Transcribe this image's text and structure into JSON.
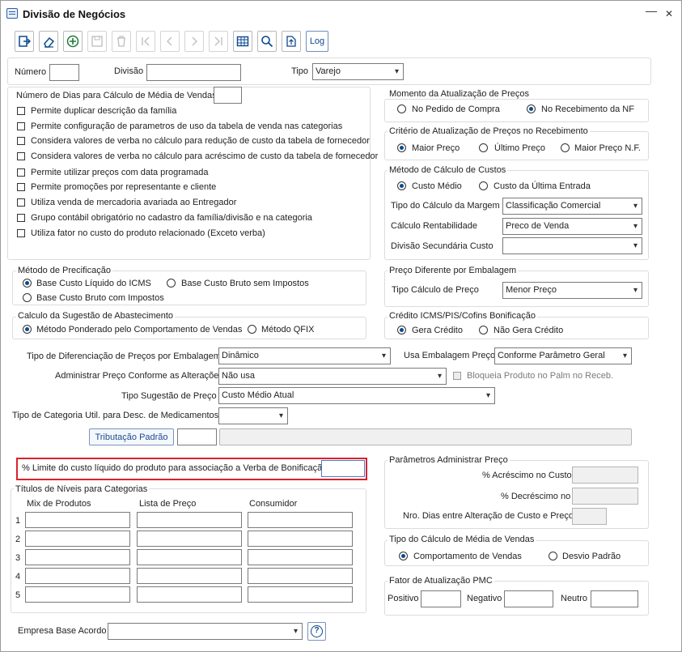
{
  "window": {
    "title": "Divisão de Negócios",
    "minimize": "—",
    "close": "✕"
  },
  "toolbar": {
    "log_label": "Log"
  },
  "header": {
    "numero_label": "Número",
    "divisao_label": "Divisão",
    "tipo_label": "Tipo",
    "tipo_value": "Varejo"
  },
  "options": {
    "dias_label": "Número de Dias para Cálculo de Média de Vendas",
    "checkboxes": [
      "Permite duplicar descrição da família",
      "Permite configuração de parametros de uso da tabela de venda nas categorias",
      "Considera valores de verba no cálculo para redução de custo da tabela de fornecedor",
      "Considera valores de verba no cálculo para acréscimo de custo da tabela de fornecedor",
      "Permite utilizar preços com data programada",
      "Permite promoções por representante e cliente",
      "Utiliza venda de mercadoria avariada ao Entregador",
      "Grupo contábil obrigatório no cadastro da família/divisão e na categoria",
      "Utiliza fator no custo do produto relacionado (Exceto verba)"
    ]
  },
  "momento": {
    "title": "Momento da Atualização de Preços",
    "opt1": "No Pedido de Compra",
    "opt2": "No Recebimento da NF"
  },
  "criterio": {
    "title": "Critério de Atualização de Preços no Recebimento",
    "opt1": "Maior Preço",
    "opt2": "Último Preço",
    "opt3": "Maior Preço N.F."
  },
  "metodo_custos": {
    "title": "Método de Cálculo de Custos",
    "opt1": "Custo Médio",
    "opt2": "Custo da Última Entrada",
    "margem_label": "Tipo do Cálculo da Margem",
    "margem_value": "Classificação Comercial",
    "rent_label": "Cálculo Rentabilidade",
    "rent_value": "Preco de Venda",
    "divsec_label": "Divisão Secundária Custo",
    "divsec_value": ""
  },
  "precificacao": {
    "title": "Método de Precificação",
    "opt1": "Base Custo Líquido do ICMS",
    "opt2": "Base Custo Bruto sem Impostos",
    "opt3": "Base Custo Bruto com Impostos"
  },
  "preco_emb": {
    "title": "Preço Diferente por Embalagem",
    "tipo_label": "Tipo Cálculo de Preço",
    "tipo_value": "Menor Preço"
  },
  "sugestao": {
    "title": "Calculo da Sugestão de Abastecimento",
    "opt1": "Método Ponderado pelo Comportamento de Vendas",
    "opt2": "Método QFIX"
  },
  "credito": {
    "title": "Crédito ICMS/PIS/Cofins Bonificação",
    "opt1": "Gera Crédito",
    "opt2": "Não Gera Crédito"
  },
  "form": {
    "dif_label": "Tipo de Diferenciação de Preços por Embalagem",
    "dif_value": "Dinâmico",
    "usa_emb_label": "Usa Embalagem Preço",
    "usa_emb_value": "Conforme Parâmetro Geral",
    "admin_label": "Administrar Preço Conforme as Alterações",
    "admin_value": "Não usa",
    "bloqueia_label": "Bloqueia Produto no Palm no Receb.",
    "sug_label": "Tipo Sugestão de Preço",
    "sug_value": "Custo Médio Atual",
    "cat_label": "Tipo de Categoria Util. para Desc. de  Medicamentos",
    "cat_value": "",
    "trib_button": "Tributação Padrão"
  },
  "limite": {
    "label": "% Limite do custo líquido do produto para associação a Verba de Bonificação"
  },
  "niveis": {
    "title": "Títulos de Níveis para Categorias",
    "col1": "Mix de Produtos",
    "col2": "Lista de Preço",
    "col3": "Consumidor",
    "rows": [
      "1",
      "2",
      "3",
      "4",
      "5"
    ]
  },
  "param_admin": {
    "title": "Parâmetros Administrar Preço",
    "acrescimo": "% Acréscimo no Custo",
    "decrescimo": "% Decréscimo no",
    "dias": "Nro. Dias entre Alteração de Custo e Preço"
  },
  "media_vendas": {
    "title": "Tipo do Cálculo de Média de Vendas",
    "opt1": "Comportamento de Vendas",
    "opt2": "Desvio Padrão"
  },
  "pmc": {
    "title": "Fator de Atualização PMC",
    "positivo": "Positivo",
    "negativo": "Negativo",
    "neutro": "Neutro"
  },
  "empresa": {
    "label": "Empresa Base Acordo",
    "value": "",
    "help": "?"
  },
  "colors": {
    "accent": "#0b4a8f",
    "highlight_border": "#d9232d"
  }
}
